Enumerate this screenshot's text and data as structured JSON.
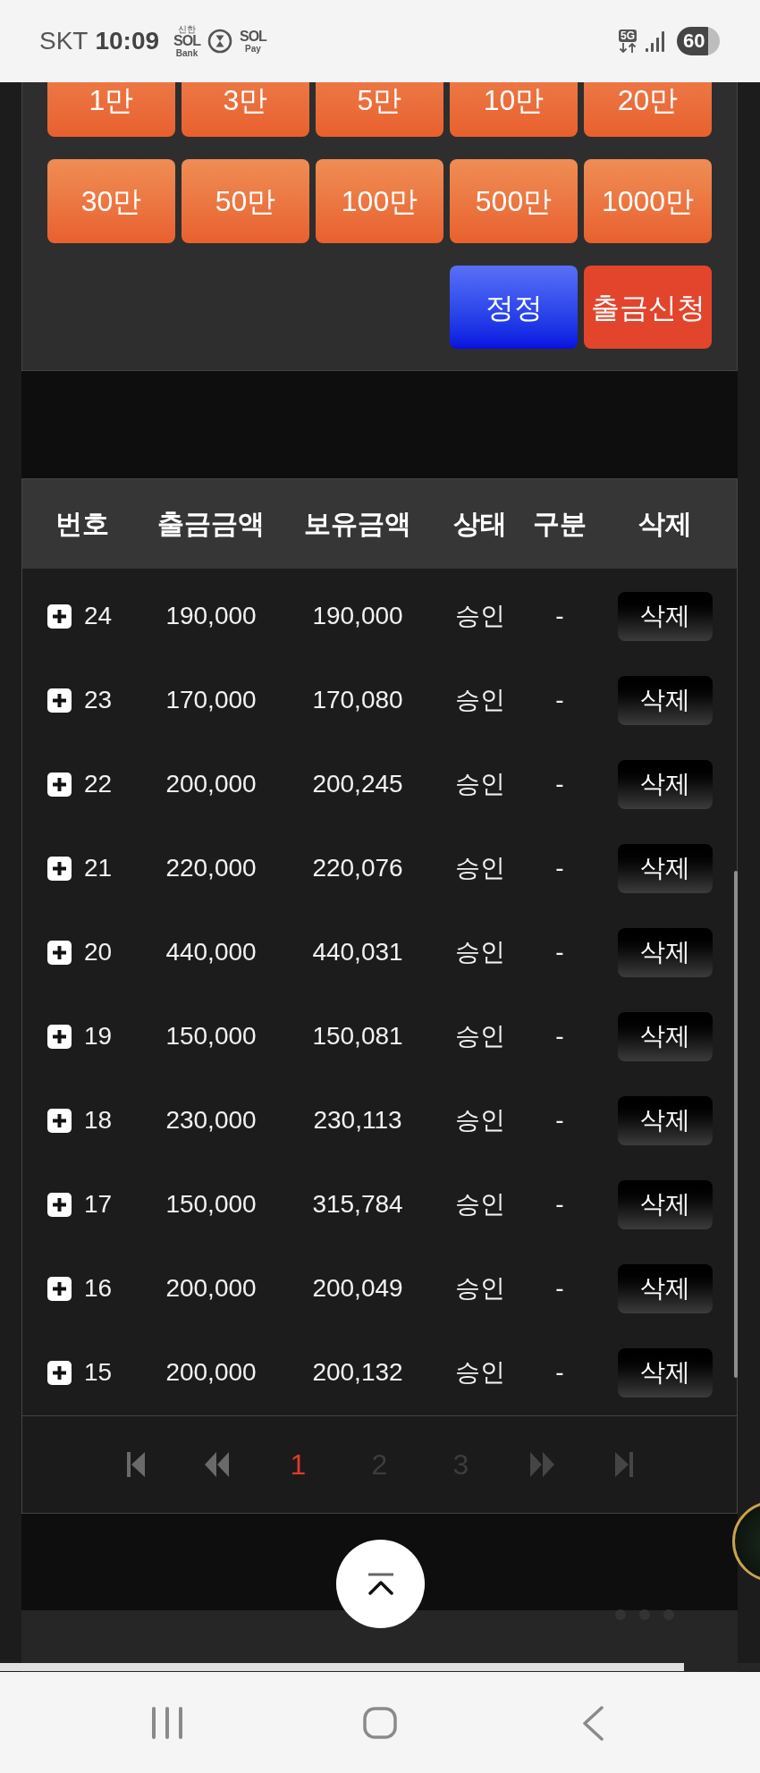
{
  "status_bar": {
    "carrier": "SKT",
    "time": "10:09",
    "notifications": [
      {
        "kind": "app",
        "brand": "신한",
        "logo": "SOL",
        "name": "Bank"
      },
      {
        "kind": "timer"
      },
      {
        "kind": "app",
        "logo": "SOL",
        "name": "Pay"
      }
    ],
    "network": "5G",
    "battery": "60"
  },
  "amount_buttons": [
    [
      "1만",
      "3만",
      "5만",
      "10만",
      "20만"
    ],
    [
      "30만",
      "50만",
      "100만",
      "500만",
      "1000만"
    ]
  ],
  "action_buttons": [
    {
      "kind": "correct",
      "label": "정정"
    },
    {
      "kind": "withdraw",
      "label": "출금신청"
    }
  ],
  "table": {
    "columns": [
      "번호",
      "출금금액",
      "보유금액",
      "상태",
      "구분",
      "삭제"
    ],
    "rows": [
      {
        "number": "24",
        "withdrawal": "190,000",
        "balance": "190,000",
        "status": "승인",
        "category": "-",
        "delete": "삭제",
        "expanded": false
      },
      {
        "number": "23",
        "withdrawal": "170,000",
        "balance": "170,080",
        "status": "승인",
        "category": "-",
        "delete": "삭제",
        "expanded": false
      },
      {
        "number": "22",
        "withdrawal": "200,000",
        "balance": "200,245",
        "status": "승인",
        "category": "-",
        "delete": "삭제",
        "expanded": false
      },
      {
        "number": "21",
        "withdrawal": "220,000",
        "balance": "220,076",
        "status": "승인",
        "category": "-",
        "delete": "삭제",
        "expanded": false
      },
      {
        "number": "20",
        "withdrawal": "440,000",
        "balance": "440,031",
        "status": "승인",
        "category": "-",
        "delete": "삭제",
        "expanded": false
      },
      {
        "number": "19",
        "withdrawal": "150,000",
        "balance": "150,081",
        "status": "승인",
        "category": "-",
        "delete": "삭제",
        "expanded": false
      },
      {
        "number": "18",
        "withdrawal": "230,000",
        "balance": "230,113",
        "status": "승인",
        "category": "-",
        "delete": "삭제",
        "expanded": false
      },
      {
        "number": "17",
        "withdrawal": "150,000",
        "balance": "315,784",
        "status": "승인",
        "category": "-",
        "delete": "삭제",
        "expanded": false
      },
      {
        "number": "16",
        "withdrawal": "200,000",
        "balance": "200,049",
        "status": "승인",
        "category": "-",
        "delete": "삭제",
        "expanded": false
      },
      {
        "number": "15",
        "withdrawal": "200,000",
        "balance": "200,132",
        "status": "승인",
        "category": "-",
        "delete": "삭제",
        "expanded": false
      }
    ]
  },
  "pagination": {
    "controls_before": [
      {
        "kind": "first"
      },
      {
        "kind": "prev"
      }
    ],
    "pages": [
      {
        "label": "1",
        "selected": true
      },
      {
        "label": "2",
        "selected": false
      },
      {
        "label": "3",
        "selected": false
      }
    ],
    "controls_after": [
      {
        "kind": "next"
      },
      {
        "kind": "last"
      }
    ]
  },
  "page_progress": {
    "level": 0.9
  }
}
